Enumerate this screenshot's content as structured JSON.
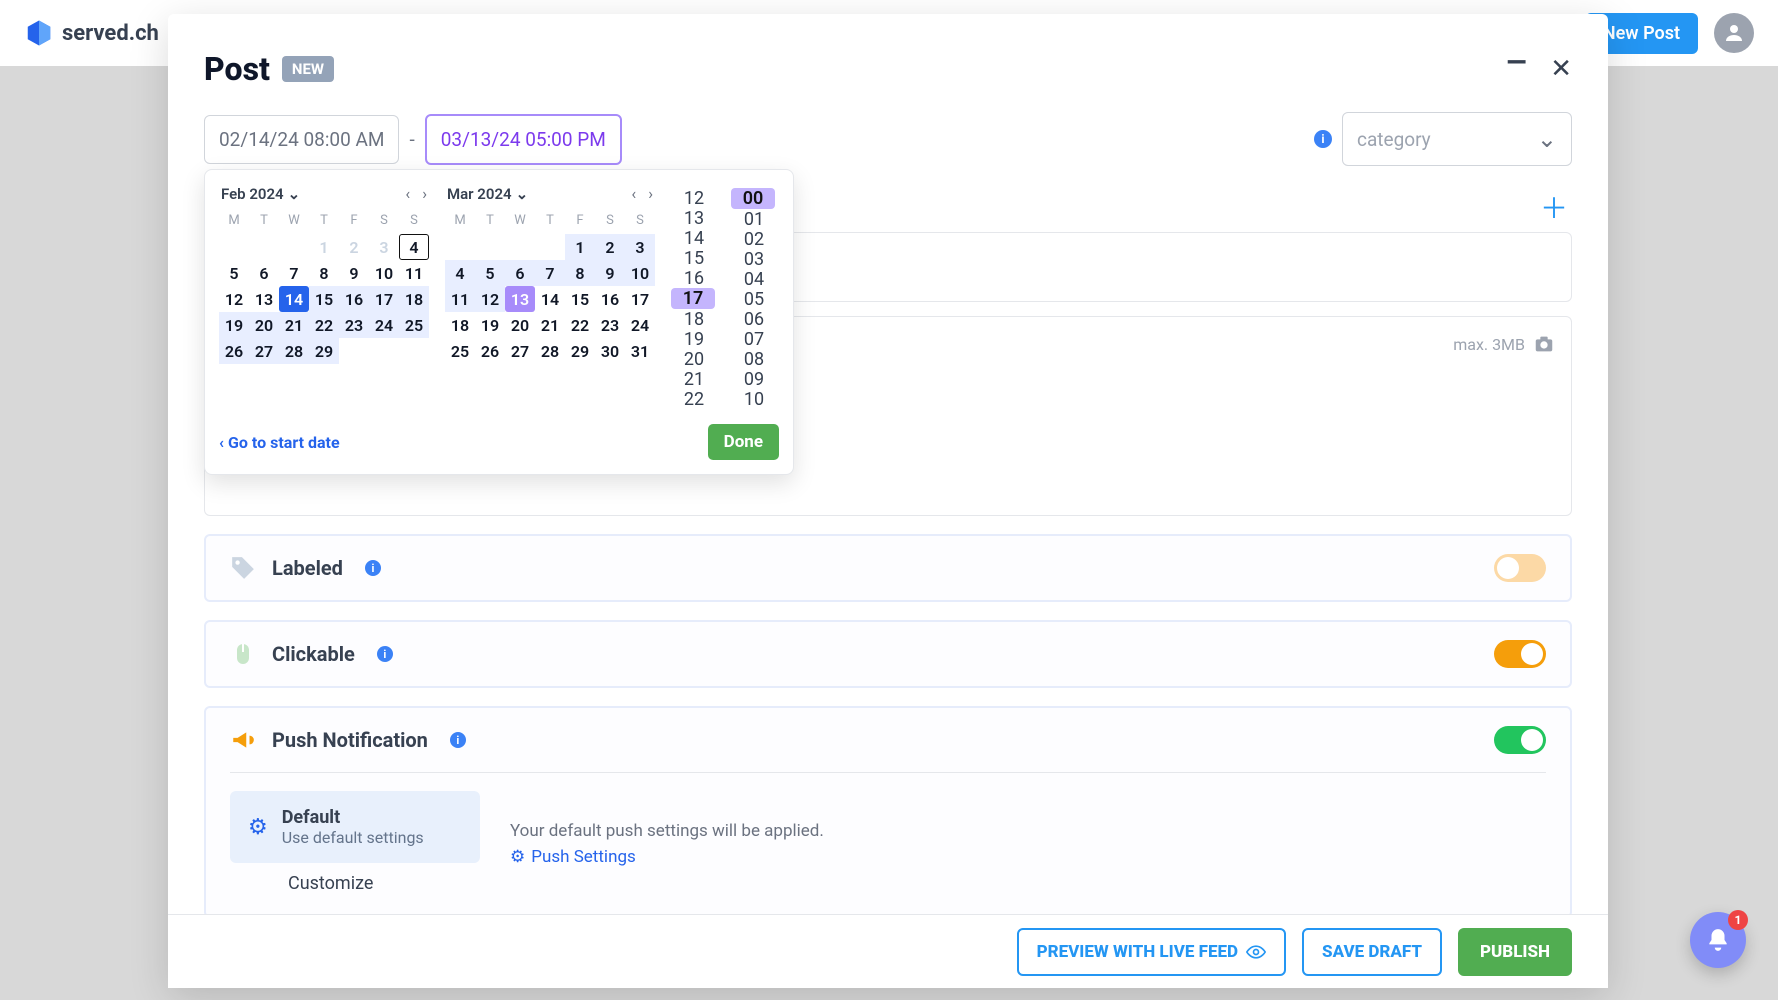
{
  "topbar": {
    "brand": "served.ch",
    "new_post": "New Post"
  },
  "modal": {
    "title": "Post",
    "badge": "NEW",
    "minimize_glyph": "_",
    "close_glyph": "✕"
  },
  "dates": {
    "start": "02/14/24 08:00 AM",
    "dash": "-",
    "end": "03/13/24 05:00 PM"
  },
  "category": {
    "placeholder": "category",
    "chevron": "⌄"
  },
  "datepicker": {
    "month1": {
      "label": "Feb 2024",
      "dow": [
        "M",
        "T",
        "W",
        "T",
        "F",
        "S",
        "S"
      ],
      "weeks": [
        [
          {
            "n": "",
            "cls": ""
          },
          {
            "n": "",
            "cls": ""
          },
          {
            "n": "",
            "cls": ""
          },
          {
            "n": "1",
            "cls": "muted"
          },
          {
            "n": "2",
            "cls": "muted"
          },
          {
            "n": "3",
            "cls": "muted"
          },
          {
            "n": "4",
            "cls": "outlined"
          }
        ],
        [
          {
            "n": "5",
            "cls": ""
          },
          {
            "n": "6",
            "cls": ""
          },
          {
            "n": "7",
            "cls": ""
          },
          {
            "n": "8",
            "cls": ""
          },
          {
            "n": "9",
            "cls": ""
          },
          {
            "n": "10",
            "cls": ""
          },
          {
            "n": "11",
            "cls": ""
          }
        ],
        [
          {
            "n": "12",
            "cls": ""
          },
          {
            "n": "13",
            "cls": ""
          },
          {
            "n": "14",
            "cls": "start"
          },
          {
            "n": "15",
            "cls": "in-range"
          },
          {
            "n": "16",
            "cls": "in-range"
          },
          {
            "n": "17",
            "cls": "in-range"
          },
          {
            "n": "18",
            "cls": "in-range"
          }
        ],
        [
          {
            "n": "19",
            "cls": "in-range"
          },
          {
            "n": "20",
            "cls": "in-range"
          },
          {
            "n": "21",
            "cls": "in-range"
          },
          {
            "n": "22",
            "cls": "in-range"
          },
          {
            "n": "23",
            "cls": "in-range"
          },
          {
            "n": "24",
            "cls": "in-range"
          },
          {
            "n": "25",
            "cls": "in-range"
          }
        ],
        [
          {
            "n": "26",
            "cls": "in-range"
          },
          {
            "n": "27",
            "cls": "in-range"
          },
          {
            "n": "28",
            "cls": "in-range"
          },
          {
            "n": "29",
            "cls": "in-range"
          },
          {
            "n": "",
            "cls": ""
          },
          {
            "n": "",
            "cls": ""
          },
          {
            "n": "",
            "cls": ""
          }
        ]
      ]
    },
    "month2": {
      "label": "Mar 2024",
      "dow": [
        "M",
        "T",
        "W",
        "T",
        "F",
        "S",
        "S"
      ],
      "weeks": [
        [
          {
            "n": "",
            "cls": ""
          },
          {
            "n": "",
            "cls": ""
          },
          {
            "n": "",
            "cls": ""
          },
          {
            "n": "",
            "cls": ""
          },
          {
            "n": "1",
            "cls": "in-range"
          },
          {
            "n": "2",
            "cls": "in-range"
          },
          {
            "n": "3",
            "cls": "in-range"
          }
        ],
        [
          {
            "n": "4",
            "cls": "in-range"
          },
          {
            "n": "5",
            "cls": "in-range"
          },
          {
            "n": "6",
            "cls": "in-range"
          },
          {
            "n": "7",
            "cls": "in-range"
          },
          {
            "n": "8",
            "cls": "in-range"
          },
          {
            "n": "9",
            "cls": "in-range"
          },
          {
            "n": "10",
            "cls": "in-range"
          }
        ],
        [
          {
            "n": "11",
            "cls": "in-range"
          },
          {
            "n": "12",
            "cls": "in-range"
          },
          {
            "n": "13",
            "cls": "end"
          },
          {
            "n": "14",
            "cls": ""
          },
          {
            "n": "15",
            "cls": ""
          },
          {
            "n": "16",
            "cls": ""
          },
          {
            "n": "17",
            "cls": ""
          }
        ],
        [
          {
            "n": "18",
            "cls": ""
          },
          {
            "n": "19",
            "cls": ""
          },
          {
            "n": "20",
            "cls": ""
          },
          {
            "n": "21",
            "cls": ""
          },
          {
            "n": "22",
            "cls": ""
          },
          {
            "n": "23",
            "cls": ""
          },
          {
            "n": "24",
            "cls": ""
          }
        ],
        [
          {
            "n": "25",
            "cls": ""
          },
          {
            "n": "26",
            "cls": ""
          },
          {
            "n": "27",
            "cls": ""
          },
          {
            "n": "28",
            "cls": ""
          },
          {
            "n": "29",
            "cls": ""
          },
          {
            "n": "30",
            "cls": ""
          },
          {
            "n": "31",
            "cls": ""
          }
        ]
      ]
    },
    "hours": [
      "12",
      "13",
      "14",
      "15",
      "16",
      "17",
      "18",
      "19",
      "20",
      "21",
      "22"
    ],
    "hours_sel": "17",
    "minutes": [
      "00",
      "01",
      "02",
      "03",
      "04",
      "05",
      "06",
      "07",
      "08",
      "09",
      "10"
    ],
    "minutes_sel": "00",
    "goto": "Go to start date",
    "done": "Done"
  },
  "image_box": {
    "max": "max. 3MB"
  },
  "options": {
    "labeled": "Labeled",
    "clickable": "Clickable",
    "push": "Push Notification",
    "push_default_title": "Default",
    "push_default_sub": "Use default settings",
    "push_msg": "Your default push settings will be applied.",
    "push_settings": "Push Settings",
    "customize": "Customize"
  },
  "footer": {
    "preview": "PREVIEW WITH LIVE FEED",
    "save": "SAVE DRAFT",
    "publish": "PUBLISH"
  },
  "notif": {
    "count": "1"
  }
}
